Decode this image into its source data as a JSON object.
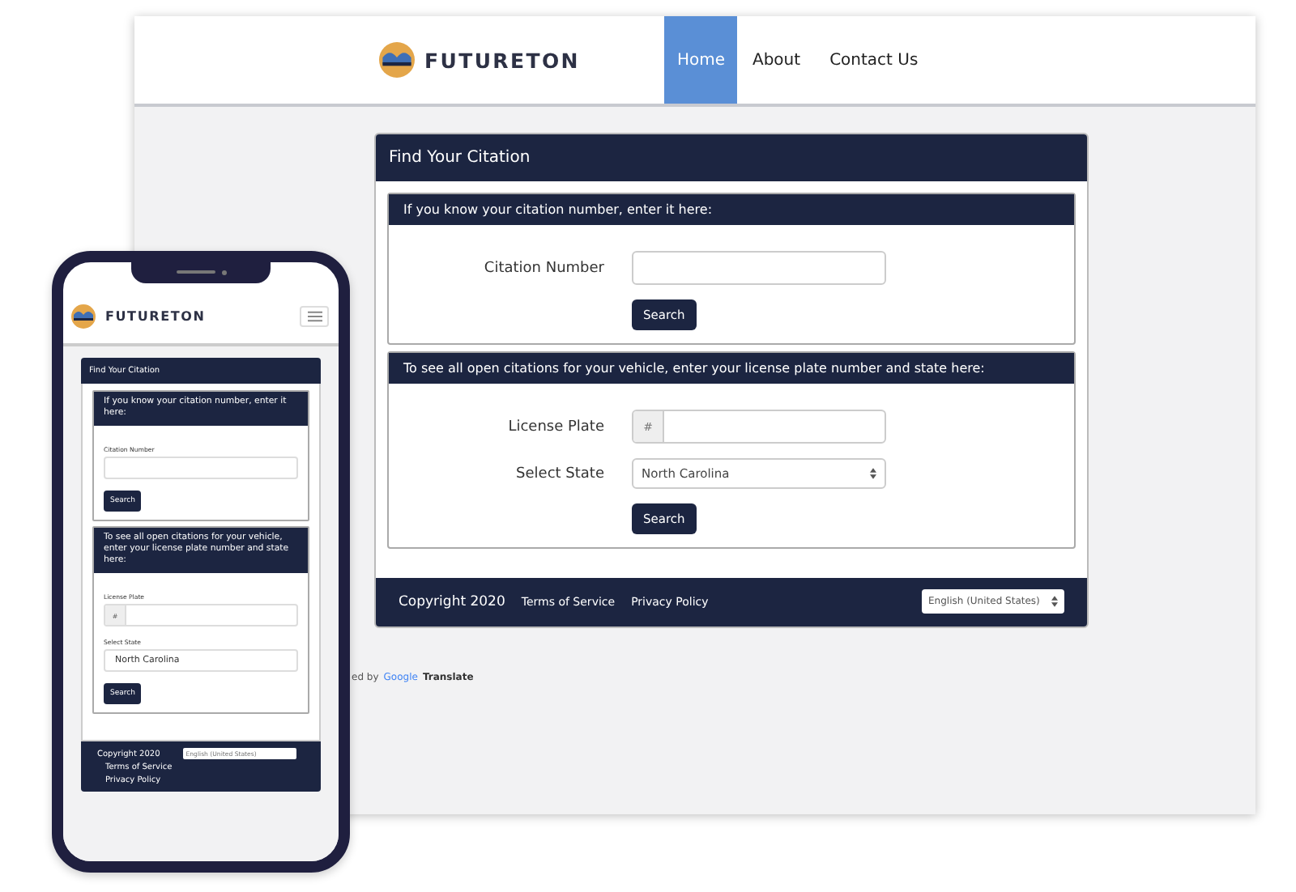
{
  "desktop": {
    "brand": "FUTURETON",
    "nav": [
      {
        "label": "Home",
        "selected": true
      },
      {
        "label": "About",
        "selected": false
      },
      {
        "label": "Contact Us",
        "selected": false
      }
    ],
    "card_title": "Find Your Citation",
    "sections": [
      {
        "heading": "If you know your citation number, enter it here:",
        "fields": [
          {
            "kind": "text",
            "label": "Citation Number"
          }
        ],
        "button": "Search"
      },
      {
        "heading": "To see all open citations for your vehicle, enter your license plate number and state here:",
        "fields": [
          {
            "kind": "plate",
            "label": "License Plate",
            "prefix": "#"
          },
          {
            "kind": "select",
            "label": "Select State",
            "value": "North Carolina"
          }
        ],
        "button": "Search"
      }
    ],
    "footer": {
      "copyright": "Copyright 2020",
      "links": [
        "Terms of Service",
        "Privacy Policy"
      ],
      "language": "English (United States)"
    },
    "powered": {
      "prefix": "ed by",
      "brand": "Google",
      "product": "Translate"
    }
  },
  "mobile": {
    "brand": "FUTURETON",
    "card_title": "Find Your Citation",
    "sections": [
      {
        "heading": "If you know your citation number, enter it here:",
        "fields": [
          {
            "kind": "text",
            "label": "Citation Number"
          }
        ],
        "button": "Search"
      },
      {
        "heading": "To see all open citations for your vehicle, enter your license plate number and state here:",
        "fields": [
          {
            "kind": "plate",
            "label": "License Plate",
            "prefix": "#"
          },
          {
            "kind": "select",
            "label": "Select State",
            "value": "North Carolina"
          }
        ],
        "button": "Search"
      }
    ],
    "footer": {
      "copyright": "Copyright 2020",
      "links": [
        "Terms of Service",
        "Privacy Policy"
      ],
      "language": "English (United States)"
    }
  }
}
